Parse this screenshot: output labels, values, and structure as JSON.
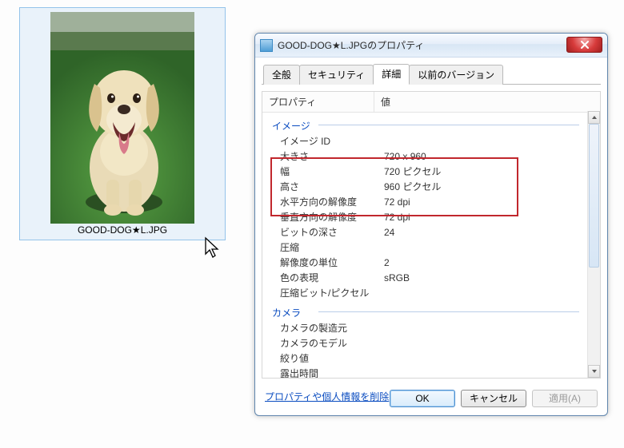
{
  "thumbnail": {
    "filename": "GOOD-DOG★L.JPG"
  },
  "dialog": {
    "title": "GOOD-DOG★L.JPGのプロパティ",
    "tabs": {
      "general": "全般",
      "security": "セキュリティ",
      "details": "詳細",
      "previous": "以前のバージョン"
    },
    "header": {
      "property": "プロパティ",
      "value": "値"
    },
    "sections": {
      "image": "イメージ",
      "camera": "カメラ"
    },
    "props": {
      "image_id_label": "イメージ ID",
      "image_id_value": "",
      "size_label": "大きさ",
      "size_value": "720 x 960",
      "width_label": "幅",
      "width_value": "720 ピクセル",
      "height_label": "高さ",
      "height_value": "960 ピクセル",
      "hres_label": "水平方向の解像度",
      "hres_value": "72 dpi",
      "vres_label": "垂直方向の解像度",
      "vres_value": "72 dpi",
      "bitdepth_label": "ビットの深さ",
      "bitdepth_value": "24",
      "compression_label": "圧縮",
      "compression_value": "",
      "resunit_label": "解像度の単位",
      "resunit_value": "2",
      "colorrep_label": "色の表現",
      "colorrep_value": "sRGB",
      "compbits_label": "圧縮ビット/ピクセル",
      "compbits_value": "",
      "cam_maker_label": "カメラの製造元",
      "cam_maker_value": "",
      "cam_model_label": "カメラのモデル",
      "cam_model_value": "",
      "fnumber_label": "絞り値",
      "fnumber_value": "",
      "exposure_label": "露出時間",
      "exposure_value": ""
    },
    "remove_link": "プロパティや個人情報を削除",
    "buttons": {
      "ok": "OK",
      "cancel": "キャンセル",
      "apply": "適用(A)"
    }
  }
}
